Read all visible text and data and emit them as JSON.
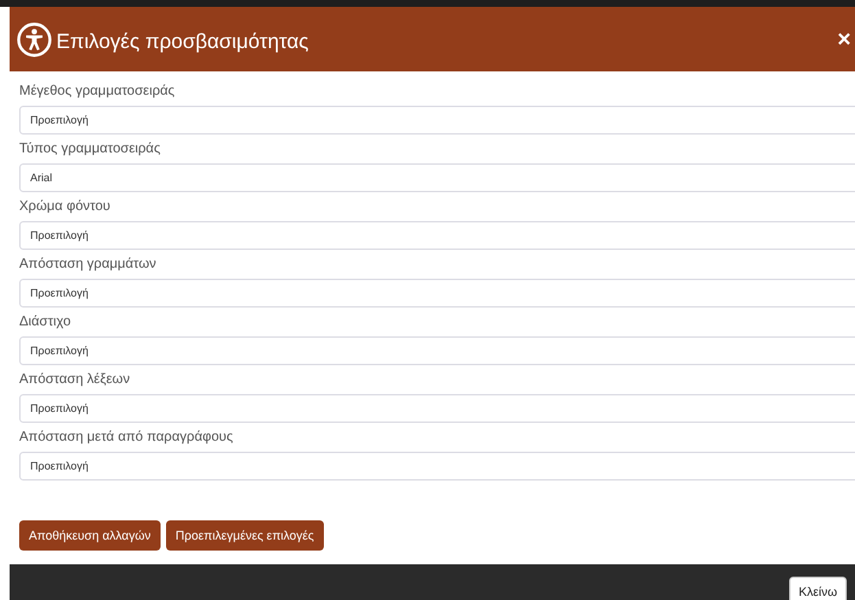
{
  "dialog": {
    "title": "Επιλογές προσβασιμότητας",
    "close": "×"
  },
  "fields": [
    {
      "label": "Μέγεθος γραμματοσειράς",
      "value": "Προεπιλογή"
    },
    {
      "label": "Τύπος γραμματοσειράς",
      "value": "Arial"
    },
    {
      "label": "Χρώμα φόντου",
      "value": "Προεπιλογή"
    },
    {
      "label": "Απόσταση γραμμάτων",
      "value": "Προεπιλογή"
    },
    {
      "label": "Διάστιχο",
      "value": "Προεπιλογή"
    },
    {
      "label": "Απόσταση λέξεων",
      "value": "Προεπιλογή"
    },
    {
      "label": "Απόσταση μετά από παραγράφους",
      "value": "Προεπιλογή"
    }
  ],
  "buttons": [
    "Αποθήκευση αλλαγών",
    "Προεπιλεγμένες επιλογές"
  ],
  "footer": {
    "button": "Κλείνω"
  }
}
